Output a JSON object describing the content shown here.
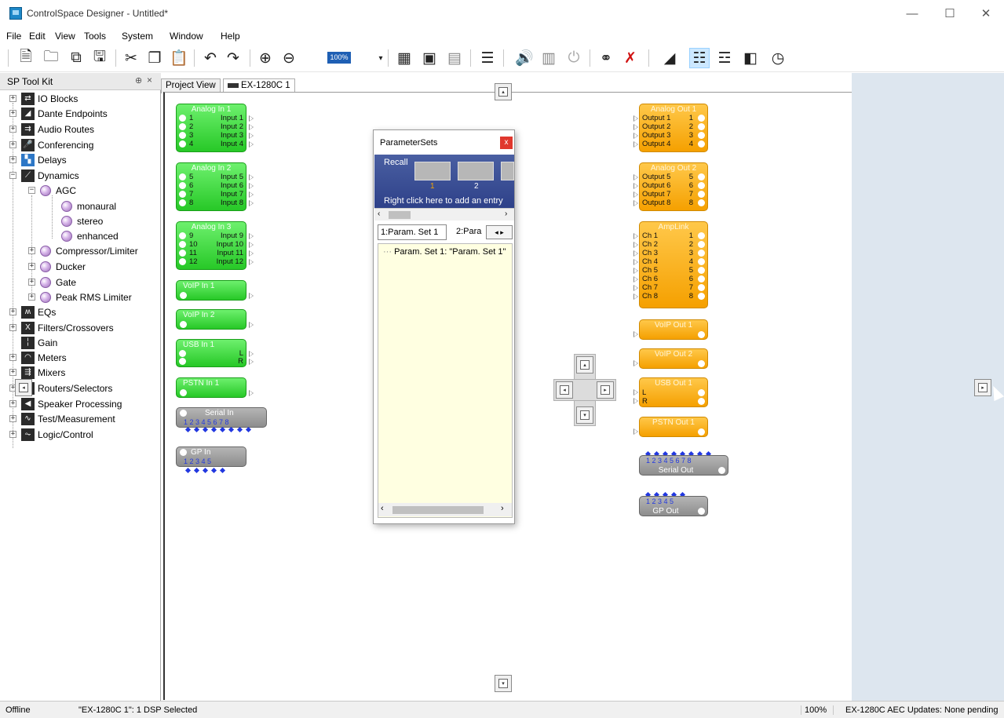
{
  "window": {
    "title": "ControlSpace Designer - Untitled*",
    "min": "—",
    "max": "☐",
    "close": "✕"
  },
  "menu": [
    "File",
    "Edit",
    "View",
    "Tools",
    "System",
    "Window",
    "Help"
  ],
  "menu_underline": [
    "F",
    "E",
    "V",
    "T",
    "S",
    "W",
    "H"
  ],
  "toolbar": {
    "zoom_label": "100%"
  },
  "toolkit": {
    "title": "SP Tool Kit",
    "pin": "⊕",
    "close": "×",
    "items": [
      {
        "label": "IO Blocks",
        "expand": "+"
      },
      {
        "label": "Dante Endpoints",
        "expand": "+"
      },
      {
        "label": "Audio Routes",
        "expand": "+"
      },
      {
        "label": "Conferencing",
        "expand": "+"
      },
      {
        "label": "Delays",
        "expand": "+"
      },
      {
        "label": "Dynamics",
        "expand": "−"
      },
      {
        "label": "AGC",
        "expand": "−"
      },
      {
        "label": "monaural"
      },
      {
        "label": "stereo"
      },
      {
        "label": "enhanced"
      },
      {
        "label": "Compressor/Limiter",
        "expand": "+"
      },
      {
        "label": "Ducker",
        "expand": "+"
      },
      {
        "label": "Gate",
        "expand": "+"
      },
      {
        "label": "Peak RMS Limiter",
        "expand": "+"
      },
      {
        "label": "EQs",
        "expand": "+"
      },
      {
        "label": "Filters/Crossovers",
        "expand": "+"
      },
      {
        "label": "Gain"
      },
      {
        "label": "Meters",
        "expand": "+"
      },
      {
        "label": "Mixers",
        "expand": "+"
      },
      {
        "label": "Routers/Selectors",
        "expand": "+"
      },
      {
        "label": "Speaker Processing",
        "expand": "+"
      },
      {
        "label": "Test/Measurement",
        "expand": "+"
      },
      {
        "label": "Logic/Control",
        "expand": "+"
      }
    ]
  },
  "tabs": {
    "project_view": "Project View",
    "device": "EX-1280C 1"
  },
  "blocks": {
    "analog_in_1": {
      "title": "Analog In 1",
      "pins": [
        "Input 1",
        "Input 2",
        "Input 3",
        "Input 4"
      ],
      "nums": [
        "1",
        "2",
        "3",
        "4"
      ]
    },
    "analog_in_2": {
      "title": "Analog In 2",
      "pins": [
        "Input 5",
        "Input 6",
        "Input 7",
        "Input 8"
      ],
      "nums": [
        "5",
        "6",
        "7",
        "8"
      ]
    },
    "analog_in_3": {
      "title": "Analog In 3",
      "pins": [
        "Input 9",
        "Input 10",
        "Input 11",
        "Input 12"
      ],
      "nums": [
        "9",
        "10",
        "11",
        "12"
      ]
    },
    "voip_in_1": {
      "title": "VoIP In 1"
    },
    "voip_in_2": {
      "title": "VoIP In 2"
    },
    "usb_in_1": {
      "title": "USB In 1",
      "pins": [
        "L",
        "R"
      ]
    },
    "pstn_in_1": {
      "title": "PSTN In 1"
    },
    "serial_in": {
      "title": "Serial In",
      "ports": "1 2 3 4 5 6 7 8"
    },
    "gp_in": {
      "title": "GP In",
      "ports": "1 2 3 4 5"
    },
    "analog_out_1": {
      "title": "Analog Out 1",
      "pins": [
        "Output 1",
        "Output 2",
        "Output 3",
        "Output 4"
      ],
      "nums": [
        "1",
        "2",
        "3",
        "4"
      ]
    },
    "analog_out_2": {
      "title": "Analog Out 2",
      "pins": [
        "Output 5",
        "Output 6",
        "Output 7",
        "Output 8"
      ],
      "nums": [
        "5",
        "6",
        "7",
        "8"
      ]
    },
    "amplink": {
      "title": "AmpLink",
      "pins": [
        "Ch 1",
        "Ch 2",
        "Ch 3",
        "Ch 4",
        "Ch 5",
        "Ch 6",
        "Ch 7",
        "Ch 8"
      ],
      "nums": [
        "1",
        "2",
        "3",
        "4",
        "5",
        "6",
        "7",
        "8"
      ]
    },
    "voip_out_1": {
      "title": "VoIP Out 1"
    },
    "voip_out_2": {
      "title": "VoIP Out 2"
    },
    "usb_out_1": {
      "title": "USB Out 1",
      "pins": [
        "L",
        "R"
      ]
    },
    "pstn_out_1": {
      "title": "PSTN Out 1"
    },
    "serial_out": {
      "title": "Serial Out",
      "ports": "1 2 3 4 5 6 7 8"
    },
    "gp_out": {
      "title": "GP Out",
      "ports": "1 2 3 4 5"
    }
  },
  "dialog": {
    "title": "ParameterSets",
    "close": "x",
    "recall_label": "Recall",
    "slot_1": "1",
    "slot_2": "2",
    "hint": "Right click here to add an entry",
    "tab_1": "1:Param. Set 1",
    "tab_2": "2:Para",
    "list_item": "Param. Set 1: \"Param. Set 1\""
  },
  "statusbar": {
    "state": "Offline",
    "selection": "\"EX-1280C 1\": 1 DSP Selected",
    "zoom": "100%",
    "updates": "EX-1280C AEC Updates: None pending"
  }
}
